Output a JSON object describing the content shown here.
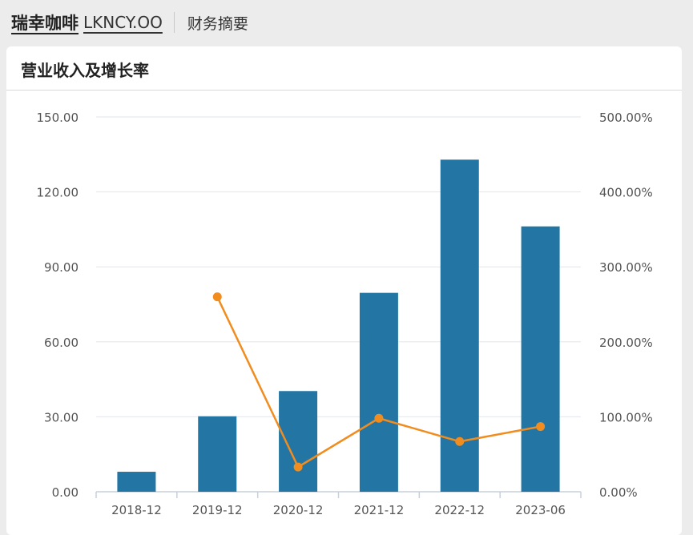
{
  "header": {
    "company": "瑞幸咖啡",
    "ticker": "LKNCY.OO",
    "section": "财务摘要"
  },
  "card": {
    "title": "营业收入及增长率"
  },
  "colors": {
    "bar": "#2376a3",
    "line": "#f18c1e",
    "grid": "#e3e6ec",
    "axis": "#c8d0dc"
  },
  "chart_data": {
    "type": "bar",
    "title": "",
    "categories": [
      "2018-12",
      "2019-12",
      "2020-12",
      "2021-12",
      "2022-12",
      "2023-06"
    ],
    "series": [
      {
        "type": "bar",
        "axis": "left",
        "values": [
          8.0,
          30.2,
          40.3,
          79.6,
          132.9,
          106.2
        ]
      },
      {
        "type": "line",
        "axis": "right",
        "values": [
          null,
          260.0,
          33.0,
          98.0,
          67.0,
          87.0
        ]
      }
    ],
    "left_axis": {
      "ylim": [
        0,
        150
      ],
      "ticks": [
        "0.00",
        "30.00",
        "60.00",
        "90.00",
        "120.00",
        "150.00"
      ]
    },
    "right_axis": {
      "ylim": [
        0,
        500
      ],
      "ticks": [
        "0.00%",
        "100.00%",
        "200.00%",
        "300.00%",
        "400.00%",
        "500.00%"
      ]
    },
    "grid": true
  }
}
